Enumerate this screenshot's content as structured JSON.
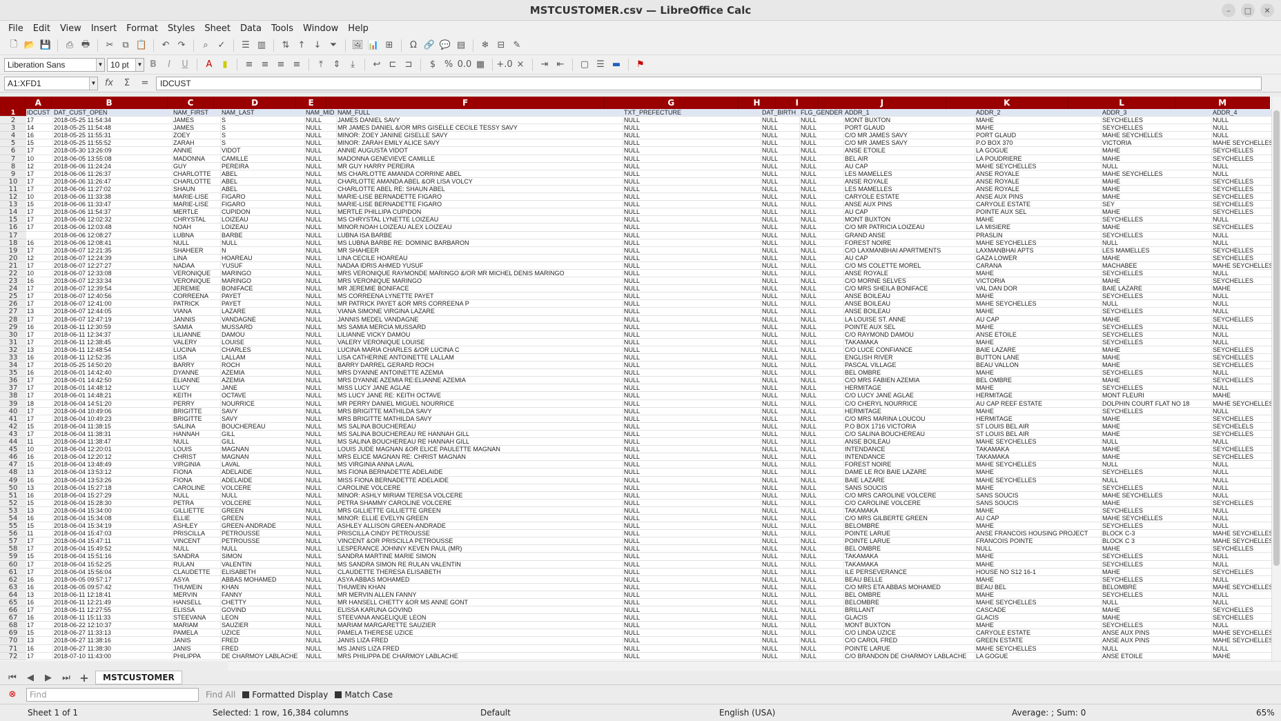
{
  "window": {
    "title": "MSTCUSTOMER.csv — LibreOffice Calc"
  },
  "menu": [
    "File",
    "Edit",
    "View",
    "Insert",
    "Format",
    "Styles",
    "Sheet",
    "Data",
    "Tools",
    "Window",
    "Help"
  ],
  "font": {
    "name": "Liberation Sans",
    "size": "10 pt"
  },
  "namebox": "A1:XFD1",
  "formula": "IDCUST",
  "columns": [
    "A",
    "B",
    "C",
    "D",
    "E",
    "F",
    "G",
    "H",
    "I",
    "J",
    "K",
    "L",
    "M"
  ],
  "header_row": [
    "IDCUST",
    "DAT_CUST_OPEN",
    "NAM_FIRST",
    "NAM_LAST",
    "NAM_MID",
    "NAM_FULL",
    "TXT_PREFECTURE",
    "DAT_BIRTH",
    "FLG_GENDER",
    "ADDR_1",
    "ADDR_2",
    "ADDR_3",
    "ADDR_4"
  ],
  "rows": [
    [
      "17",
      "2018-05-25 11:54:34",
      "JAMES",
      "S",
      "NULL",
      "JAMES DANIEL SAVY",
      "NULL",
      "NULL",
      "NULL",
      "MONT BUXTON",
      "MAHE",
      "SEYCHELLES",
      "NULL"
    ],
    [
      "14",
      "2018-05-25 11:54:48",
      "JAMES",
      "S",
      "NULL",
      "MR JAMES DANIEL &/OR MRS GISELLE CECILE TESSY SAVY",
      "NULL",
      "NULL",
      "NULL",
      "PORT GLAUD",
      "MAHE",
      "SEYCHELLES",
      "NULL"
    ],
    [
      "16",
      "2018-05-25 11:55:31",
      "ZOEY",
      "S",
      "NULL",
      "MINOR: ZOEY JANINE GISELLE SAVY",
      "NULL",
      "NULL",
      "NULL",
      "C/O MR JAMES SAVY",
      "PORT GLAUD",
      "MAHE SEYCHELLES",
      "NULL"
    ],
    [
      "15",
      "2018-05-25 11:55:52",
      "ZARAH",
      "S",
      "NULL",
      "MINOR: ZARAH EMILY ALICE SAVY",
      "NULL",
      "NULL",
      "NULL",
      "C/O MR JAMES SAVY",
      "P.O BOX 370",
      "VICTORIA",
      "MAHE SEYCHELLES"
    ],
    [
      "17",
      "2018-05-30 13:26:09",
      "ANNIE",
      "VIDOT",
      "NULL",
      "ANNIE AUGUSTA VIDOT",
      "NULL",
      "NULL",
      "NULL",
      "ANSE ETOILE",
      "LA GOGUE",
      "MAHE",
      "SEYCHELLES"
    ],
    [
      "10",
      "2018-06-05 13:55:08",
      "MADONNA",
      "CAMILLE",
      "NULL",
      "MADONNA GENEVIEVE CAMILLE",
      "NULL",
      "NULL",
      "NULL",
      "BEL AIR",
      "LA POUDRIERE",
      "MAHE",
      "SEYCHELLES"
    ],
    [
      "12",
      "2018-06-06 11:24:24",
      "GUY",
      "PEREIRA",
      "NULL",
      "MR GUY HARRY PEREIRA",
      "NULL",
      "NULL",
      "NULL",
      "AU CAP",
      "MAHE SEYCHELLES",
      "NULL",
      "NULL"
    ],
    [
      "17",
      "2018-06-06 11:26:37",
      "CHARLOTTE",
      "ABEL",
      "NULL",
      "MS CHARLOTTE AMANDA CORRINE ABEL",
      "NULL",
      "NULL",
      "NULL",
      "LES MAMELLES",
      "ANSE ROYALE",
      "MAHE SEYCHELLES",
      "NULL"
    ],
    [
      "17",
      "2018-06-06 11:26:47",
      "CHARLOTTE",
      "ABEL",
      "NULL",
      "CHARLOTTE AMANDA ABEL &OR LISA VOLCY",
      "NULL",
      "NULL",
      "NULL",
      "ANSE ROYALE",
      "ANSE ROYALE",
      "MAHE",
      "SEYCHELLES"
    ],
    [
      "17",
      "2018-06-06 11:27:02",
      "SHAUN",
      "ABEL",
      "NULL",
      "CHARLOTTE ABEL RE: SHAUN ABEL",
      "NULL",
      "NULL",
      "NULL",
      "LES MAMELLES",
      "ANSE ROYALE",
      "MAHE",
      "SEYCHELLES"
    ],
    [
      "10",
      "2018-06-06 11:33:38",
      "MARIE-LISE",
      "FIGARO",
      "NULL",
      "MARIE-LISE BERNADETTE FIGARO",
      "NULL",
      "NULL",
      "NULL",
      "CARYOLE ESTATE",
      "ANSE AUX PINS",
      "MAHE",
      "SEYCHELLES"
    ],
    [
      "15",
      "2018-06-06 11:33:47",
      "MARIE-LISE",
      "FIGARO",
      "NULL",
      "MARIE-LISE BERNADETTE FIGARO",
      "NULL",
      "NULL",
      "NULL",
      "ANSE AUX PINS",
      "CARYOLE ESTATE",
      "SEY",
      "SEYCHELLES"
    ],
    [
      "17",
      "2018-06-06 11:54:37",
      "MERTLE",
      "CUPIDON",
      "NULL",
      "MERTLE PHILLIPA CUPIDON",
      "NULL",
      "NULL",
      "NULL",
      "AU CAP",
      "POINTE AUX SEL",
      "MAHE",
      "SEYCHELLES"
    ],
    [
      "17",
      "2018-06-06 12:02:32",
      "CHRYSTAL",
      "LOIZEAU",
      "NULL",
      "MS CHRYSTAL LYNETTE LOIZEAU",
      "NULL",
      "NULL",
      "NULL",
      "MONT BUXTON",
      "MAHE",
      "SEYCHELLES",
      "NULL"
    ],
    [
      "17",
      "2018-06-06 12:03:48",
      "NOAH",
      "LOIZEAU",
      "NULL",
      "MINOR:NOAH LOIZEAU ALEX LOIZEAU",
      "NULL",
      "NULL",
      "NULL",
      "C/O MR PATRICIA LOIZEAU",
      "LA MISIERE",
      "MAHE",
      "SEYCHELLES"
    ],
    [
      "",
      "2018-06-06 12:08:27",
      "LUBNA",
      "BARBE",
      "NULL",
      "LUBNA ISA BARBE",
      "NULL",
      "NULL",
      "NULL",
      "GRAND ANSE",
      "PRASLIN",
      "SEYCHELLES",
      "NULL"
    ],
    [
      "16",
      "2018-06-06 12:08:41",
      "NULL",
      "NULL",
      "NULL",
      "MS LUBNA BARBE RE: DOMINIC BARBARON",
      "NULL",
      "NULL",
      "NULL",
      "FOREST NOIRE",
      "MAHE SEYCHELLES",
      "NULL",
      "NULL"
    ],
    [
      "17",
      "2018-06-07 12:21:35",
      "SHAHEER",
      "N",
      "NULL",
      "MR SHAHEER",
      "NULL",
      "NULL",
      "NULL",
      "C/O LAXMANBHAI APARTMENTS",
      "LAXMANBHAI APTS",
      "LES MAMELLES",
      "SEYCHELLES"
    ],
    [
      "12",
      "2018-06-07 12:24:39",
      "LINA",
      "HOAREAU",
      "NULL",
      "LINA CECILE HOAREAU",
      "NULL",
      "NULL",
      "NULL",
      "AU CAP",
      "GAZA LOWER",
      "MAHE",
      "SEYCHELLES"
    ],
    [
      "17",
      "2018-06-07 12:27:27",
      "NADAA",
      "YUSUF",
      "NULL",
      "NADAA IDRIS AHMED YUSUF",
      "NULL",
      "NULL",
      "NULL",
      "C/O MS COLETTE MOREL",
      "CARANA",
      "MACHABEE",
      "MAHE SEYCHELLES"
    ],
    [
      "10",
      "2018-06-07 12:33:08",
      "VERONIQUE",
      "MARINGO",
      "NULL",
      "MRS VERONIQUE RAYMONDE MARINGO &/OR MR MICHEL DENIS MARINGO",
      "NULL",
      "NULL",
      "NULL",
      "ANSE ROYALE",
      "MAHE",
      "SEYCHELLES",
      "NULL"
    ],
    [
      "16",
      "2018-06-07 12:33:34",
      "VERONIQUE",
      "MARINGO",
      "NULL",
      "MRS VERONIQUE MARINGO",
      "NULL",
      "NULL",
      "NULL",
      "C/O MORNE SELVES",
      "VICTORIA",
      "MAHE",
      "SEYCHELLES"
    ],
    [
      "17",
      "2018-06-07 12:39:54",
      "JEREMIE",
      "BONIFACE",
      "NULL",
      "MR JEREMIE BONIFACE",
      "NULL",
      "NULL",
      "NULL",
      "C/O MRS SHEILA BONIFACE",
      "VAL DAN DOR",
      "BAIE LAZARE",
      "MAHE"
    ],
    [
      "17",
      "2018-06-07 12:40:56",
      "CORREENA",
      "PAYET",
      "NULL",
      "MS CORREENA LYNETTE PAYET",
      "NULL",
      "NULL",
      "NULL",
      "ANSE BOILEAU",
      "MAHE",
      "SEYCHELLES",
      "NULL"
    ],
    [
      "17",
      "2018-06-07 12:41:00",
      "PATRICK",
      "PAYET",
      "NULL",
      "MR PATRICK PAYET &OR MRS CORREENA P",
      "NULL",
      "NULL",
      "NULL",
      "ANSE BOILEAU",
      "MAHE SEYCHELLES",
      "NULL",
      "NULL"
    ],
    [
      "13",
      "2018-06-07 12:44:05",
      "VIANA",
      "LAZARE",
      "NULL",
      "VIANA SIMONE VIRGINA LAZARE",
      "NULL",
      "NULL",
      "NULL",
      "ANSE BOILEAU",
      "MAHE",
      "SEYCHELLES",
      "NULL"
    ],
    [
      "17",
      "2018-06-07 12:47:19",
      "JANNIS",
      "VANDAGNE",
      "NULL",
      "JANNIS MEDEL VANDAGNE",
      "NULL",
      "NULL",
      "NULL",
      "LA LOUISE ST. ANNE",
      "AU CAP",
      "MAHE",
      "SEYCHELLES"
    ],
    [
      "16",
      "2018-06-11 12:30:59",
      "SAMIA",
      "MUSSARD",
      "NULL",
      "MS SAMIA MERCIA MUSSARD",
      "NULL",
      "NULL",
      "NULL",
      "POINTE AUX SEL",
      "MAHE",
      "SEYCHELLES",
      "NULL"
    ],
    [
      "17",
      "2018-06-11 12:34:37",
      "LILIANNE",
      "DAMOU",
      "NULL",
      "LILIANNE VICKY DAMOU",
      "NULL",
      "NULL",
      "NULL",
      "C/O RAYMOND DAMOU",
      "ANSE ETOILE",
      "SEYCHELLES",
      "NULL"
    ],
    [
      "17",
      "2018-06-11 12:38:45",
      "VALERY",
      "LOUISE",
      "NULL",
      "VALERY VERONIQUE LOUISE",
      "NULL",
      "NULL",
      "NULL",
      "TAKAMAKA",
      "MAHE",
      "SEYCHELLES",
      "NULL"
    ],
    [
      "13",
      "2018-06-11 12:48:54",
      "LUCINA",
      "CHARLES",
      "NULL",
      "LUCINA MARIA CHARLES &/OR LUCINA C",
      "NULL",
      "NULL",
      "NULL",
      "C/O LUCE CONFIANCE",
      "BAIE LAZARE",
      "MAHE",
      "SEYCHELLES"
    ],
    [
      "16",
      "2018-06-11 12:52:35",
      "LISA",
      "LALLAM",
      "NULL",
      "LISA CATHERINE ANTOINETTE LALLAM",
      "NULL",
      "NULL",
      "NULL",
      "ENGLISH RIVER",
      "BUTTON LANE",
      "MAHE",
      "SEYCHELLES"
    ],
    [
      "17",
      "2018-05-25 14:50:20",
      "BARRY",
      "ROCH",
      "NULL",
      "BARRY DARREL GERARD ROCH",
      "NULL",
      "NULL",
      "NULL",
      "PASCAL VILLAGE",
      "BEAU VALLON",
      "MAHE",
      "SEYCHELLES"
    ],
    [
      "16",
      "2018-06-01 14:42:40",
      "DYANNE",
      "AZEMIA",
      "NULL",
      "MRS DYANNE ANTOINETTE AZEMIA",
      "NULL",
      "NULL",
      "NULL",
      "BEL OMBRE",
      "MAHE",
      "SEYCHELLES",
      "NULL"
    ],
    [
      "17",
      "2018-06-01 14:42:50",
      "ELIANNE",
      "AZEMIA",
      "NULL",
      "MRS DYANNE AZEMIA RE:ELIANNE AZEMIA",
      "NULL",
      "NULL",
      "NULL",
      "C/O MRS FABIEN AZEMIA",
      "BEL OMBRE",
      "MAHE",
      "SEYCHELLES"
    ],
    [
      "17",
      "2018-06-01 14:48:12",
      "LUCY",
      "JANE",
      "NULL",
      "MISS LUCY JANE AGLAE",
      "NULL",
      "NULL",
      "NULL",
      "HERMITAGE",
      "MAHE",
      "SEYCHELLES",
      "NULL"
    ],
    [
      "17",
      "2018-06-01 14:48:21",
      "KEITH",
      "OCTAVE",
      "NULL",
      "MS LUCY JANE RE: KEITH OCTAVE",
      "NULL",
      "NULL",
      "NULL",
      "C/O LUCY JANE AGLAE",
      "HERMITAGE",
      "MONT FLEURI",
      "MAHE"
    ],
    [
      "18",
      "2018-06-04 14:51:20",
      "PERRY",
      "NOURRICE",
      "NULL",
      "MR PERRY DANIEL MIGUEL NOURRICE",
      "NULL",
      "NULL",
      "NULL",
      "C/O CHERYL NOURRICE",
      "AU CAP REEF ESTATE",
      "DOLPHIN COURT FLAT NO 18",
      "MAHE SEYCHELLES"
    ],
    [
      "17",
      "2018-06-04 10:49:06",
      "BRIGITTE",
      "SAVY",
      "NULL",
      "MRS BRIGITTE MATHILDA SAVY",
      "NULL",
      "NULL",
      "NULL",
      "HERMITAGE",
      "MAHE",
      "SEYCHELLES",
      "NULL"
    ],
    [
      "17",
      "2018-06-04 10:49:23",
      "BRIGITTE",
      "SAVY",
      "NULL",
      "MRS BRIGITTE MATHILDA SAVY",
      "NULL",
      "NULL",
      "NULL",
      "C/O MRS MARINA LOUCOU",
      "HERMITAGE",
      "MAHE",
      "SEYCHELLES"
    ],
    [
      "15",
      "2018-06-04 11:38:15",
      "SALINA",
      "BOUCHEREAU",
      "NULL",
      "MS SALINA BOUCHEREAU",
      "NULL",
      "NULL",
      "NULL",
      "P.O BOX 1716 VICTORIA",
      "ST LOUIS BEL AIR",
      "MAHE",
      "SEYCHELELS"
    ],
    [
      "17",
      "2018-06-04 11:38:31",
      "HANNAH",
      "GILL",
      "NULL",
      "MS SALINA BOUCHEREAU RE HANNAH GILL",
      "NULL",
      "NULL",
      "NULL",
      "C/O SALINA BOUCHEREAU",
      "ST LOUIS BEL AIR",
      "MAHE",
      "SEYCHELLES"
    ],
    [
      "11",
      "2018-06-04 11:38:47",
      "NULL",
      "GILL",
      "NULL",
      "MS SALINA BOUCHEREAU RE HANNAH GILL",
      "NULL",
      "NULL",
      "NULL",
      "ANSE BOILEAU",
      "MAHE SEYCHELLES",
      "NULL",
      "NULL"
    ],
    [
      "10",
      "2018-06-04 12:20:01",
      "LOUIS",
      "MAGNAN",
      "NULL",
      "LOUIS JUDE MAGNAN &OR ELICE PAULETTE MAGNAN",
      "NULL",
      "NULL",
      "NULL",
      "INTENDANCE",
      "TAKAMAKA",
      "MAHE",
      "SEYCHELLES"
    ],
    [
      "16",
      "2018-06-04 12:20:12",
      "CHRIST",
      "MAGNAN",
      "NULL",
      "MRS ELICE MAGNAN RE: CHRIST MAGNAN",
      "NULL",
      "NULL",
      "NULL",
      "INTENDANCE",
      "TAKAMAKA",
      "MAHE",
      "SEYCHELLES"
    ],
    [
      "15",
      "2018-06-04 13:48:49",
      "VIRGINIA",
      "LAVAL",
      "NULL",
      "MS VIRGINIA ANNA LAVAL",
      "NULL",
      "NULL",
      "NULL",
      "FOREST NOIRE",
      "MAHE SEYCHELLES",
      "NULL",
      "NULL"
    ],
    [
      "13",
      "2018-06-04 13:53:12",
      "FIONA",
      "ADELAIDE",
      "NULL",
      "MS FIONA BERNADETTE ADELAIDE",
      "NULL",
      "NULL",
      "NULL",
      "DAME LE ROI BAIE LAZARE",
      "MAHE",
      "SEYCHELLES",
      "NULL"
    ],
    [
      "16",
      "2018-06-04 13:53:26",
      "FIONA",
      "ADELAIDE",
      "NULL",
      "MISS FIONA BERNADETTE ADELAIDE",
      "NULL",
      "NULL",
      "NULL",
      "BAIE LAZARE",
      "MAHE SEYCHELLES",
      "NULL",
      "NULL"
    ],
    [
      "13",
      "2018-06-04 15:27:18",
      "CAROLINE",
      "VOLCERE",
      "NULL",
      "CAROLINE VOLCERE",
      "NULL",
      "NULL",
      "NULL",
      "SANS SOUCIS",
      "MAHE",
      "SEYCHELLES",
      "NULL"
    ],
    [
      "16",
      "2018-06-04 15:27:29",
      "NULL",
      "NULL",
      "NULL",
      "MINOR: ASHLY MIRIAM TERESA VOLCERE",
      "NULL",
      "NULL",
      "NULL",
      "C/O MRS CAROLINE VOLCERE",
      "SANS SOUCIS",
      "MAHE SEYCHELLES",
      "NULL"
    ],
    [
      "15",
      "2018-06-04 15:28:30",
      "PETRA",
      "VOLCERE",
      "NULL",
      "PETRA SHAMMY CAROLINE VOLCERE",
      "NULL",
      "NULL",
      "NULL",
      "C/O CAROLINE VOLCERE",
      "SANS SOUCIS",
      "MAHE",
      "SEYCHELLES"
    ],
    [
      "13",
      "2018-06-04 15:34:00",
      "GILLIETTE",
      "GREEN",
      "NULL",
      "MRS GILLIETTE GILLIETTE GREEN",
      "NULL",
      "NULL",
      "NULL",
      "TAKAMAKA",
      "MAHE",
      "SEYCHELLES",
      "NULL"
    ],
    [
      "16",
      "2018-06-04 15:34:08",
      "ELLIE",
      "GREEN",
      "NULL",
      "MINOR: ELLIE EVELYN GREEN",
      "NULL",
      "NULL",
      "NULL",
      "C/O MRS GILBERTE GREEN",
      "AU CAP",
      "MAHE SEYCHELLES",
      "NULL"
    ],
    [
      "15",
      "2018-06-04 15:34:19",
      "ASHLEY",
      "GREEN-ANDRADE",
      "NULL",
      "ASHLEY ALLISON GREEN-ANDRADE",
      "NULL",
      "NULL",
      "NULL",
      "BELOMBRE",
      "MAHE",
      "SEYCHELLES",
      "NULL"
    ],
    [
      "11",
      "2018-06-04 15:47:03",
      "PRISCILLA",
      "PETROUSSE",
      "NULL",
      "PRISCILLA CINDY PETROUSSE",
      "NULL",
      "NULL",
      "NULL",
      "POINTE LARUE",
      "ANSE FRANCOIS HOUSING PROJECT",
      "BLOCK C-3",
      "MAHE SEYCHELLES"
    ],
    [
      "17",
      "2018-06-04 15:47:11",
      "VINCENT",
      "PETROUSSE",
      "NULL",
      "VINCENT &OR PRISCILLA PETROUSSE",
      "NULL",
      "NULL",
      "NULL",
      "POINTE LARUE",
      "FRANCOIS POINTE",
      "BLOCK C 3",
      "MAHE SEYCHELLES"
    ],
    [
      "17",
      "2018-06-04 15:49:52",
      "NULL",
      "NULL",
      "NULL",
      "LESPERANCE JOHNNY KEVEN PAUL (MR)",
      "NULL",
      "NULL",
      "NULL",
      "BEL OMBRE",
      "NULL",
      "MAHE",
      "SEYCHELLES"
    ],
    [
      "15",
      "2018-06-04 15:51:16",
      "SANDRA",
      "SIMON",
      "NULL",
      "SANDRA MARTINE MARIE SIMON",
      "NULL",
      "NULL",
      "NULL",
      "TAKAMAKA",
      "MAHE",
      "SEYCHELLES",
      "NULL"
    ],
    [
      "17",
      "2018-06-04 15:52:25",
      "RULAN",
      "VALENTIN",
      "NULL",
      "MS SANDRA SIMON RE RULAN VALENTIN",
      "NULL",
      "NULL",
      "NULL",
      "TAKAMAKA",
      "MAHE",
      "SEYCHELLES",
      "NULL"
    ],
    [
      "17",
      "2018-06-04 15:56:04",
      "CLAUDETTE",
      "ELISABETH",
      "NULL",
      "CLAUDETTE THERESA ELISABETH",
      "NULL",
      "NULL",
      "NULL",
      "ILE PERSEVERANCE",
      "HOUSE NO S12 16-1",
      "MAHE",
      "SEYCHELLES"
    ],
    [
      "16",
      "2018-06-05 09:57:17",
      "ASYA",
      "ABBAS MOHAMED",
      "NULL",
      "ASYA ABBAS MOHAMED",
      "NULL",
      "NULL",
      "NULL",
      "BEAU BELLE",
      "MAHE",
      "SEYCHELLES",
      "NULL"
    ],
    [
      "16",
      "2018-06-05 09:57:42",
      "THUWEIN",
      "KHAN",
      "NULL",
      "THUWEIN KHAN",
      "NULL",
      "NULL",
      "NULL",
      "C/O MRS ETA ABBAS MOHAMED",
      "BEAU BEL",
      "BELOMBRE",
      "MAHE SEYCHELLES"
    ],
    [
      "13",
      "2018-06-11 12:18:41",
      "MERVIN",
      "FANNY",
      "NULL",
      "MR MERVIN ALLEN FANNY",
      "NULL",
      "NULL",
      "NULL",
      "BEL OMBRE",
      "MAHE",
      "SEYCHELLES",
      "NULL"
    ],
    [
      "16",
      "2018-06-11 12:21:49",
      "HANSELL",
      "CHETTY",
      "NULL",
      "MR HANSELL CHETTY &OR MS ANNE GONT",
      "NULL",
      "NULL",
      "NULL",
      "BELOMBRE",
      "MAHE SEYCHELLES",
      "NULL",
      "NULL"
    ],
    [
      "17",
      "2018-06-11 12:27:55",
      "ELISSA",
      "GOVIND",
      "NULL",
      "ELISSA KARUNA GOVIND",
      "NULL",
      "NULL",
      "NULL",
      "BRILLANT",
      "CASCADE",
      "MAHE",
      "SEYCHELLES"
    ],
    [
      "16",
      "2018-06-11 15:11:33",
      "STEEVANA",
      "LEON",
      "NULL",
      "STEEVANA ANGELIQUE LEON",
      "NULL",
      "NULL",
      "NULL",
      "GLACIS",
      "GLACIS",
      "MAHE",
      "SEYCHELLES"
    ],
    [
      "17",
      "2018-06-22 12:10:37",
      "MARIAM",
      "SAUZIER",
      "NULL",
      "MARIAM MARGARETTE SAUZIER",
      "NULL",
      "NULL",
      "NULL",
      "MONT BUXTON",
      "MAHE",
      "SEYCHELLES",
      "NULL"
    ],
    [
      "15",
      "2018-06-27 11:33:13",
      "PAMELA",
      "UZICE",
      "NULL",
      "PAMELA THERESE UZICE",
      "NULL",
      "NULL",
      "NULL",
      "C/O LINDA UZICE",
      "CARYOLE ESTATE",
      "ANSE AUX PINS",
      "MAHE SEYCHELLES"
    ],
    [
      "13",
      "2018-06-27 11:38:16",
      "JANIS",
      "FRED",
      "NULL",
      "JANIS LIZA FRED",
      "NULL",
      "NULL",
      "NULL",
      "C/O CAROL FRED",
      "GREEN ESTATE",
      "ANSE AUX PINS",
      "MAHE SEYCHELLES"
    ],
    [
      "16",
      "2018-06-27 11:38:30",
      "JANIS",
      "FRED",
      "NULL",
      "MS JANIS LIZA FRED",
      "NULL",
      "NULL",
      "NULL",
      "POINTE LARUE",
      "MAHE SEYCHELLES",
      "NULL",
      "NULL"
    ],
    [
      "17",
      "2018-07-10 11:43:00",
      "PHILIPPA",
      "DE CHARMOY LABLACHE",
      "NULL",
      "MRS PHILIPPA DE CHARMOY LABLACHE",
      "NULL",
      "NULL",
      "NULL",
      "C/O BRANDON DE CHARMOY LABLACHE",
      "LA GOGUE",
      "ANSE ETOILE",
      "MAHE"
    ]
  ],
  "sheet_tab": "MSTCUSTOMER",
  "find": {
    "placeholder": "Find",
    "find_all": "Find All",
    "formatted_display": "Formatted Display",
    "match_case": "Match Case"
  },
  "status": {
    "sheet": "Sheet 1 of 1",
    "selection": "Selected: 1 row, 16,384 columns",
    "style": "Default",
    "language": "English (USA)",
    "sum": "Average: ; Sum: 0",
    "zoom": "65%"
  }
}
